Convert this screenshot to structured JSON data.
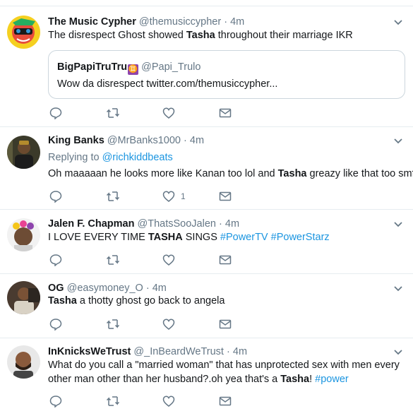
{
  "tweets": [
    {
      "name": "The Music Cypher",
      "handle": "@themusiccypher",
      "dot": "·",
      "time": "4m",
      "body_pre": "The disrespect Ghost showed ",
      "body_bold": "Tasha",
      "body_post": " throughout their marriage IKR",
      "quote": {
        "name": "BigPapiTruTru",
        "emoji": "♊",
        "handle": "@Papi_Trulo",
        "text": "Wow da disrespect twitter.com/themusiccypher..."
      }
    },
    {
      "name": "King Banks",
      "handle": "@MrBanks1000",
      "dot": "·",
      "time": "4m",
      "replying_label": "Replying to ",
      "replying_handle": "@richkiddbeats",
      "body_pre": "Oh maaaaan he looks more like Kanan too lol and ",
      "body_bold": "Tasha",
      "body_post": " greazy like that too smfh",
      "like_count": "1"
    },
    {
      "name": "Jalen F. Chapman",
      "handle": "@ThatsSooJalen",
      "dot": "·",
      "time": "4m",
      "body_pre": "I LOVE EVERY TIME ",
      "body_bold": "TASHA",
      "body_post": " SINGS ",
      "hashtag1": "#PowerTV",
      "hashtag2": "#PowerStarz"
    },
    {
      "name": "OG",
      "handle": "@easymoney_O",
      "dot": "·",
      "time": "4m",
      "body_bold": "Tasha",
      "body_post": " a thotty ghost go back to angela"
    },
    {
      "name": "InKnicksWeTrust",
      "handle": "@_InBeardWeTrust",
      "dot": "·",
      "time": "4m",
      "line1": "What do you call a \"married woman\" that has unprotected sex with men every",
      "line2_pre": "other man other than her husband?.oh yea that's a ",
      "line2_bold": "Tasha",
      "line2_post": "! ",
      "hashtag": "#power"
    }
  ],
  "icons": {
    "reply": "reply-icon",
    "retweet": "retweet-icon",
    "like": "heart-icon",
    "dm": "envelope-icon",
    "more": "chevron-down-icon"
  },
  "colors": {
    "link": "#1b95e0",
    "muted": "#657786",
    "divider": "#e6ecf0",
    "text": "#14171a"
  }
}
